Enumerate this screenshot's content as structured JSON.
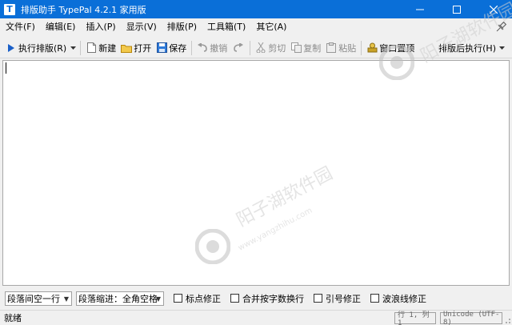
{
  "titlebar": {
    "app_icon_letter": "T",
    "title": "排版助手 TypePal 4.2.1 家用版",
    "minimize_icon": "minimize-icon",
    "maximize_icon": "maximize-icon",
    "close_icon": "close-icon"
  },
  "menu": {
    "items": [
      {
        "label": "文件(F)"
      },
      {
        "label": "编辑(E)"
      },
      {
        "label": "插入(P)"
      },
      {
        "label": "显示(V)"
      },
      {
        "label": "排版(P)"
      },
      {
        "label": "工具箱(T)"
      },
      {
        "label": "其它(A)"
      }
    ],
    "pin_icon": "pin-icon"
  },
  "toolbar": {
    "typeset_label": "执行排版(R)",
    "new_label": "新建",
    "open_label": "打开",
    "save_label": "保存",
    "undo_label": "撤销",
    "cut_label": "剪切",
    "copy_label": "复制",
    "paste_label": "粘贴",
    "pin_window_label": "窗口置顶",
    "after_typeset_label": "排版后执行(H)"
  },
  "options": {
    "paragraph_spacing": "段落间空一行",
    "paragraph_indent": "段落缩进：全角空格",
    "checks": [
      {
        "label": "标点修正",
        "checked": false
      },
      {
        "label": "合并按字数换行",
        "checked": false
      },
      {
        "label": "引号修正",
        "checked": false
      },
      {
        "label": "波浪线修正",
        "checked": false
      }
    ]
  },
  "status": {
    "text": "就绪",
    "position": "行 1, 列 1",
    "encoding": "Unicode (UTF-8)"
  },
  "watermark": {
    "name": "阳子湖软件园",
    "url": "www.yangzhihu.com"
  },
  "colors": {
    "titlebar_bg": "#0a6fd8",
    "window_bg": "#f0f0f0",
    "editor_bg": "#ffffff"
  }
}
